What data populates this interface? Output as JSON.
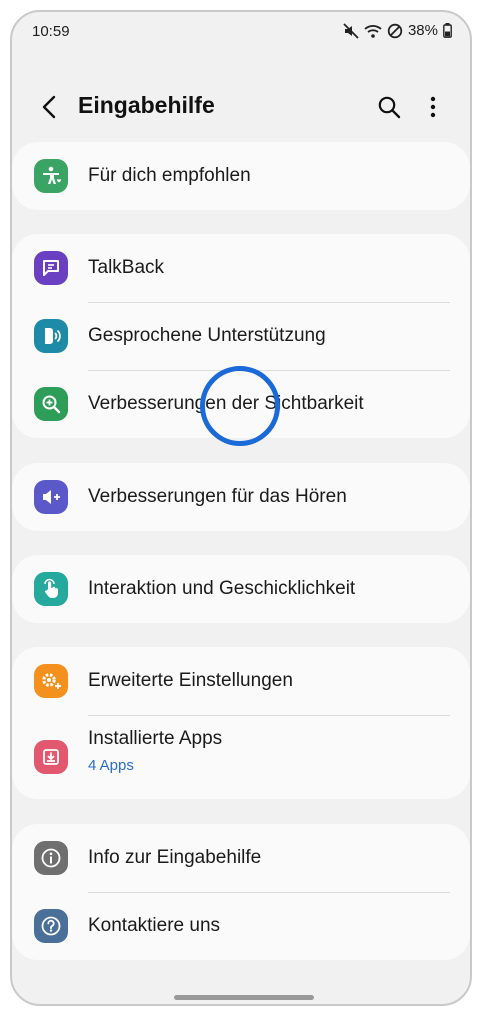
{
  "status": {
    "time": "10:59",
    "battery": "38%",
    "icons": [
      "mute-icon",
      "wifi-icon",
      "dnd-icon",
      "battery-icon"
    ]
  },
  "appbar": {
    "title": "Eingabehilfe",
    "icons": [
      "back-arrow-icon",
      "search-icon",
      "more-vert-icon"
    ]
  },
  "groups": [
    {
      "items": [
        {
          "label": "Für dich empfohlen",
          "icon": "accessibility-person-icon",
          "color": "#3aa464"
        }
      ]
    },
    {
      "items": [
        {
          "label": "TalkBack",
          "icon": "speech-bubble-icon",
          "color": "#6a3fc2"
        },
        {
          "label": "Gesprochene Unterstützung",
          "icon": "speaking-head-icon",
          "color": "#1d8aa8"
        },
        {
          "label": "Verbesserungen der Sichtbarkeit",
          "icon": "magnifier-plus-icon",
          "color": "#2e9d57"
        }
      ]
    },
    {
      "items": [
        {
          "label": "Verbesserungen für das Hören",
          "icon": "volume-plus-icon",
          "color": "#5b59c9"
        }
      ]
    },
    {
      "items": [
        {
          "label": "Interaktion und Geschicklichkeit",
          "icon": "hand-touch-icon",
          "color": "#25a99c"
        }
      ]
    },
    {
      "items": [
        {
          "label": "Erweiterte Einstellungen",
          "icon": "gear-plus-icon",
          "color": "#f4901e"
        },
        {
          "label": "Installierte Apps",
          "sub": "4 Apps",
          "icon": "download-box-icon",
          "color": "#e2586f"
        }
      ]
    },
    {
      "items": [
        {
          "label": "Info zur Eingabehilfe",
          "icon": "info-icon",
          "color": "#6f6f6f"
        },
        {
          "label": "Kontaktiere uns",
          "icon": "question-icon",
          "color": "#4a6f98"
        }
      ]
    }
  ]
}
